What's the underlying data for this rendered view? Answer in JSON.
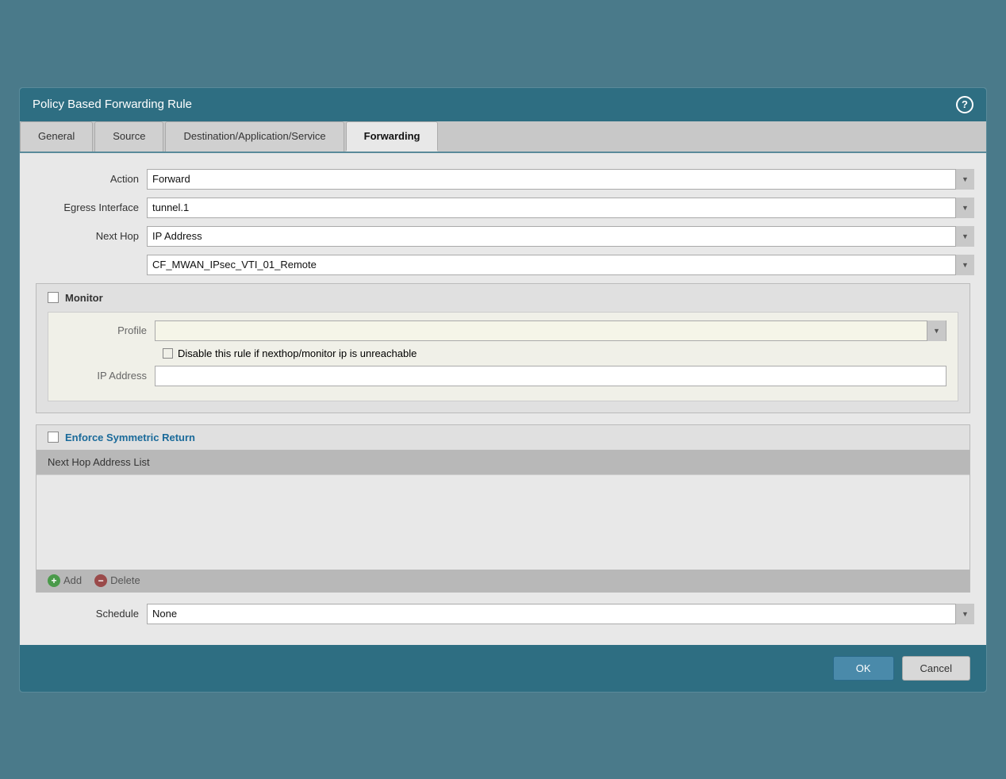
{
  "dialog": {
    "title": "Policy Based Forwarding Rule",
    "help_icon": "?"
  },
  "tabs": [
    {
      "label": "General",
      "active": false
    },
    {
      "label": "Source",
      "active": false
    },
    {
      "label": "Destination/Application/Service",
      "active": false
    },
    {
      "label": "Forwarding",
      "active": true
    }
  ],
  "form": {
    "action_label": "Action",
    "action_value": "Forward",
    "egress_interface_label": "Egress Interface",
    "egress_interface_value": "tunnel.1",
    "next_hop_label": "Next Hop",
    "next_hop_value": "IP Address",
    "next_hop_second_value": "CF_MWAN_IPsec_VTI_01_Remote",
    "monitor_label": "Monitor",
    "profile_label": "Profile",
    "profile_value": "",
    "disable_rule_label": "Disable this rule if nexthop/monitor ip is unreachable",
    "ip_address_label": "IP Address",
    "enforce_label": "Enforce Symmetric Return",
    "next_hop_address_list_label": "Next Hop Address List",
    "add_label": "Add",
    "delete_label": "Delete",
    "schedule_label": "Schedule",
    "schedule_value": "None",
    "ok_label": "OK",
    "cancel_label": "Cancel"
  }
}
